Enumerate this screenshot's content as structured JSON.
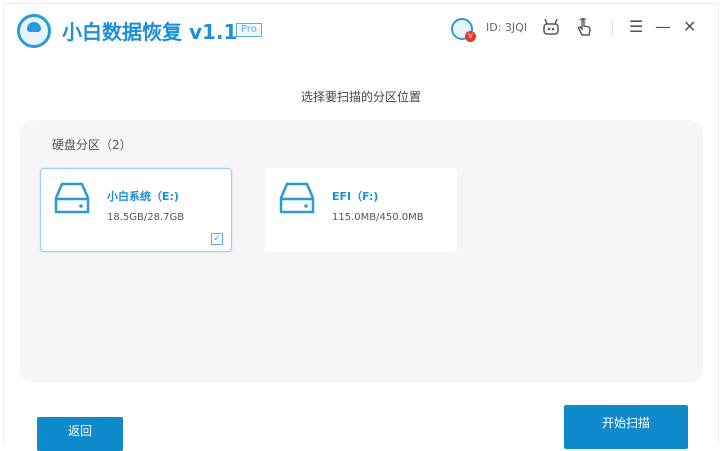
{
  "app": {
    "title": "小白数据恢复 v1.1",
    "edition": "Pro"
  },
  "header": {
    "user_id": "ID: 3JQI",
    "badge": "V",
    "icons": [
      "avatar-icon",
      "robot-icon",
      "hand-pointer-icon",
      "menu-icon",
      "minimize-icon",
      "close-icon"
    ],
    "menu_glyph": "☰",
    "minimize_glyph": "—",
    "close_glyph": "✕"
  },
  "main": {
    "subtitle": "选择要扫描的分区位置",
    "section_label": "硬盘分区（2）",
    "partitions": [
      {
        "name": "小白系统（E:)",
        "size": "18.5GB/28.7GB",
        "selected": true
      },
      {
        "name": "EFI（F:)",
        "size": "115.0MB/450.0MB",
        "selected": false
      }
    ]
  },
  "footer": {
    "back_label": "返回",
    "start_label": "开始扫描"
  },
  "colors": {
    "accent": "#1e8fd6",
    "button": "#0f8acb",
    "panel": "#f6f6f6"
  }
}
